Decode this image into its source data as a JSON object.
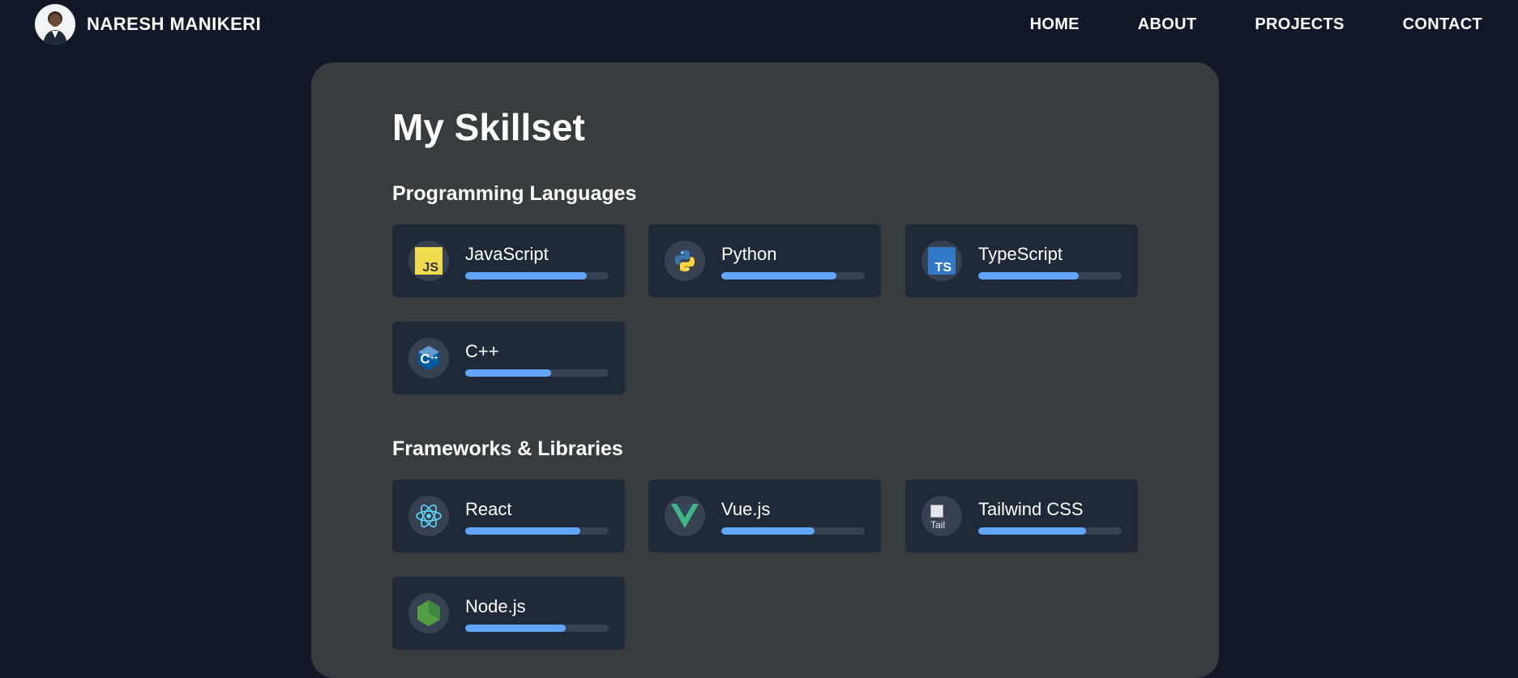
{
  "header": {
    "brand_name": "NARESH MANIKERI",
    "nav": [
      "HOME",
      "ABOUT",
      "PROJECTS",
      "CONTACT"
    ]
  },
  "page_title": "My Skillset",
  "sections": [
    {
      "title": "Programming Languages",
      "skills": [
        {
          "name": "JavaScript",
          "icon": "javascript-icon",
          "level": 0.85
        },
        {
          "name": "Python",
          "icon": "python-icon",
          "level": 0.8
        },
        {
          "name": "TypeScript",
          "icon": "typescript-icon",
          "level": 0.7
        },
        {
          "name": "C++",
          "icon": "cplusplus-icon",
          "level": 0.6
        }
      ]
    },
    {
      "title": "Frameworks & Libraries",
      "skills": [
        {
          "name": "React",
          "icon": "react-icon",
          "level": 0.8
        },
        {
          "name": "Vue.js",
          "icon": "vue-icon",
          "level": 0.65
        },
        {
          "name": "Tailwind CSS",
          "icon": "broken-image-icon",
          "icon_alt": "Tail",
          "level": 0.75
        },
        {
          "name": "Node.js",
          "icon": "nodejs-icon",
          "level": 0.7
        }
      ]
    }
  ],
  "colors": {
    "background": "#111827",
    "panel": "#373c3f",
    "card": "#1f2937",
    "bar_track": "#374151",
    "bar_fill": "#60a5fa"
  }
}
